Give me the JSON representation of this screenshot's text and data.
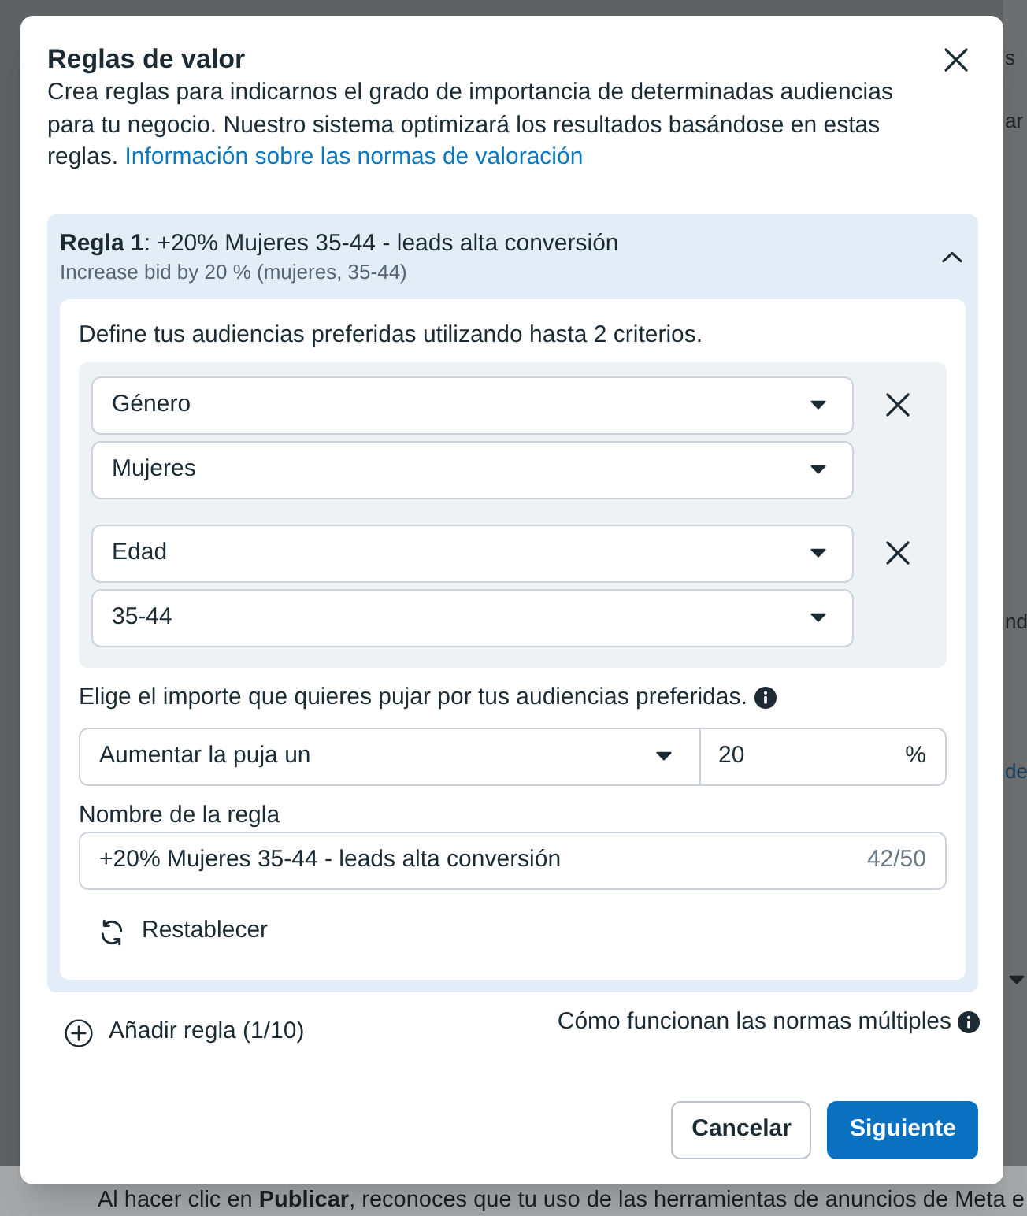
{
  "background_page": {
    "edge_texts": [
      {
        "text": "s",
        "kind": "text"
      },
      {
        "text": "ar",
        "kind": "text"
      },
      {
        "text": "nd",
        "kind": "text"
      },
      {
        "text": "de",
        "kind": "link"
      }
    ],
    "notice": "Al hacer clic en **Publicar**, reconoces que tu uso de las herramientas de anuncios de Meta e"
  },
  "dialog": {
    "title": "Reglas de valor",
    "description": "Crea reglas para indicarnos el grado de importancia de determinadas audiencias para tu negocio. Nuestro sistema optimizará los resultados basándose en estas reglas.",
    "link": "Información sobre las normas de valoración"
  },
  "rules": [
    {
      "title": "**Regla 1**: +20% Mujeres 35-44 - leads alta conversión",
      "summary": "Increase bid by 20 % (mujeres, 35-44)",
      "expanded": true,
      "criteria_prompt": "Define tus audiencias preferidas utilizando hasta 2 criterios.",
      "criteria": [
        {
          "field": "Género",
          "value": "Mujeres"
        },
        {
          "field": "Edad",
          "value": "35-44"
        }
      ],
      "bid_prompt": "Elige el importe que quieres pujar por tus audiencias preferidas.",
      "bid_action": "Aumentar la puja un",
      "bid_amount": "20",
      "bid_unit": "%",
      "name_label": "Nombre de la regla",
      "name_value": "+20% Mujeres 35-44 - leads alta conversión",
      "name_counter": "42/50",
      "reset_label": "Restablecer"
    }
  ],
  "add_rule": "Añadir regla (1/10)",
  "multiple_rules_help": "Cómo funcionan las normas múltiples",
  "buttons": [
    {
      "label": "Cancelar",
      "kind": "secondary"
    },
    {
      "label": "Siguiente",
      "kind": "primary"
    }
  ]
}
